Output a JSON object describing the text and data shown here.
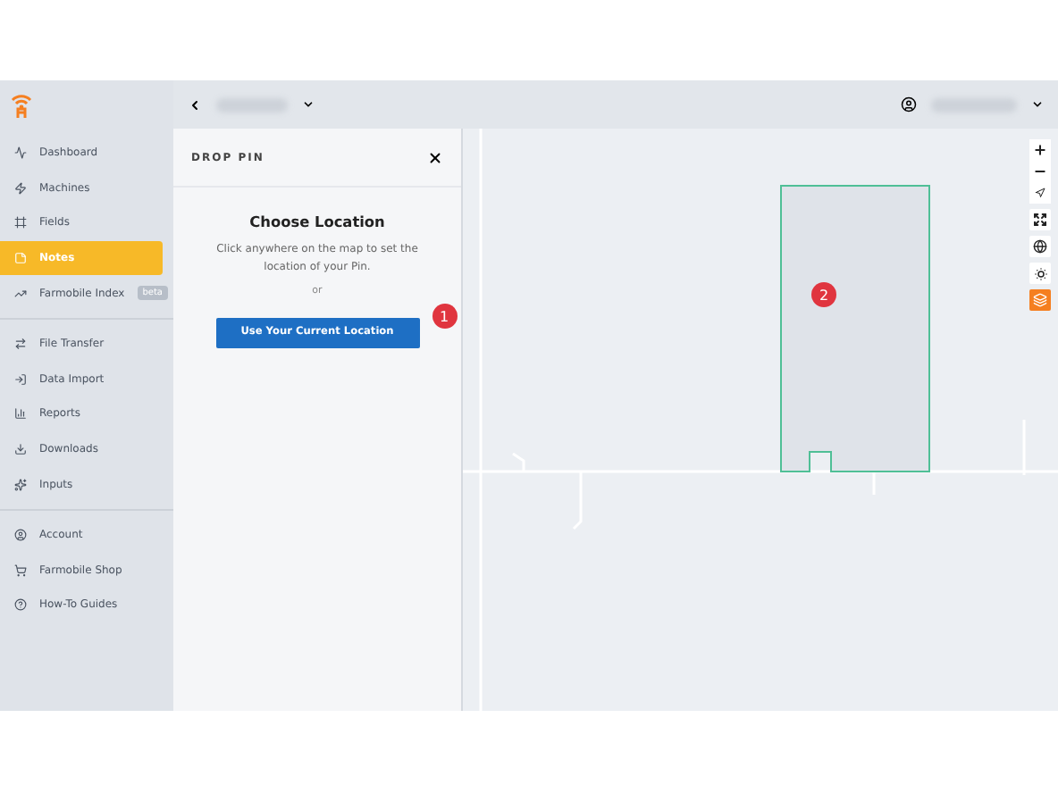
{
  "sidebar": {
    "sections": [
      {
        "items": [
          {
            "label": "Dashboard",
            "selected": false
          },
          {
            "label": "Machines",
            "selected": false
          },
          {
            "label": "Fields",
            "selected": false
          },
          {
            "label": "Notes",
            "selected": true
          },
          {
            "label": "Farmobile Index",
            "selected": false,
            "badge": "beta"
          }
        ]
      },
      {
        "items": [
          {
            "label": "File Transfer",
            "selected": false
          },
          {
            "label": "Data Import",
            "selected": false
          },
          {
            "label": "Reports",
            "selected": false
          },
          {
            "label": "Downloads",
            "selected": false
          },
          {
            "label": "Inputs",
            "selected": false
          }
        ]
      },
      {
        "items": [
          {
            "label": "Account",
            "selected": false
          },
          {
            "label": "Farmobile Shop",
            "selected": false
          },
          {
            "label": "How-To Guides",
            "selected": false
          }
        ]
      }
    ]
  },
  "panel": {
    "title": "DROP PIN",
    "heading": "Choose Location",
    "text": "Click anywhere on the map to set the location of your Pin.",
    "separator": "or",
    "button": "Use Your Current Location",
    "marker": "1"
  },
  "map": {
    "marker": "2"
  }
}
